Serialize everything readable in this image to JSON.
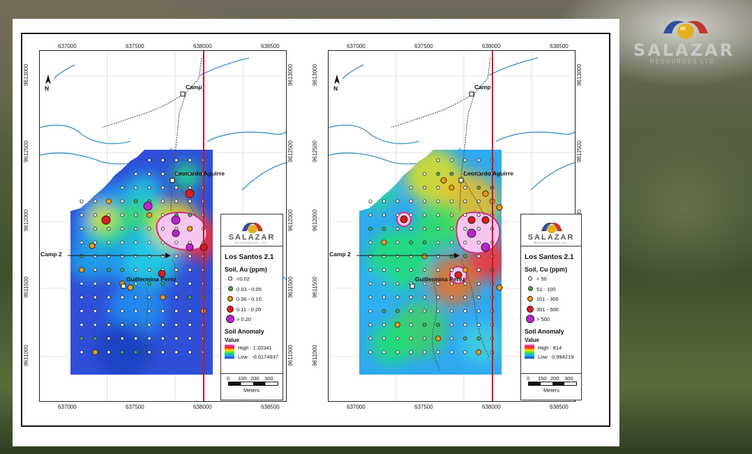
{
  "brand": {
    "name": "SALAZAR",
    "sub": "RESOURCES LTD.",
    "colors": {
      "red": "#c0392b",
      "blue": "#2c4f9e",
      "gold": "#e2b021"
    }
  },
  "x_ticks": [
    "637000",
    "637500",
    "638000",
    "638500"
  ],
  "y_ticks": [
    "9613000",
    "9612500",
    "9612000",
    "9611500",
    "9611000"
  ],
  "north_label": "N",
  "place_labels": {
    "camp": "Camp",
    "camp2": "Camp 2",
    "leonardo": "Leonardo Aguirre",
    "guillermina": "Guillermina Perez"
  },
  "scalebar": {
    "ticks": [
      "0",
      "100",
      "200",
      "300"
    ],
    "unit": "Meters"
  },
  "maps": [
    {
      "legend": {
        "logo_name": "SALAZAR",
        "logo_sub": "RESOURCES LTD.",
        "title": "Los Santos 2.1",
        "soil_label": "Soil, Au (ppm)",
        "classes": [
          {
            "label": "<0.02",
            "color": "#ffffff"
          },
          {
            "label": "0.03 - 0.05",
            "color": "#4caf50"
          },
          {
            "label": "0.06 - 0.10",
            "color": "#f39c12"
          },
          {
            "label": "0.11 - 0.20",
            "color": "#e01b1b"
          },
          {
            "label": "> 0.20",
            "color": "#c020d0"
          }
        ],
        "anomaly_label": "Soil Anomaly",
        "value_label": "Value",
        "high": "High : 1.20341",
        "low": "Low : -0.0174937"
      }
    },
    {
      "legend": {
        "logo_name": "SALAZAR",
        "logo_sub": "RESOURCES LTD.",
        "title": "Los Santos 2.1",
        "soil_label": "Soil, Cu (ppm)",
        "classes": [
          {
            "label": "< 50",
            "color": "#ffffff"
          },
          {
            "label": "51 - 100",
            "color": "#4caf50"
          },
          {
            "label": "101 - 300",
            "color": "#f39c12"
          },
          {
            "label": "301 - 500",
            "color": "#e01b1b"
          },
          {
            "label": "> 500",
            "color": "#c020d0"
          }
        ],
        "anomaly_label": "Soil Anomaly",
        "value_label": "Value",
        "high": "High : 814",
        "low": "Low : 0.994219"
      }
    }
  ]
}
